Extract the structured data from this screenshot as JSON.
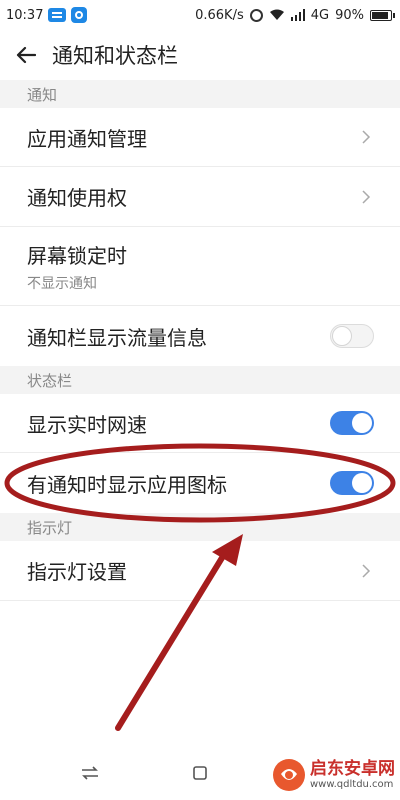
{
  "status_bar": {
    "time": "10:37",
    "speed": "0.66K/s",
    "network": "4G",
    "battery": "90%",
    "icons": [
      "message-icon",
      "app-icon",
      "alarm-icon",
      "wifi-icon",
      "signal-icon",
      "battery-icon"
    ]
  },
  "header": {
    "title": "通知和状态栏",
    "back_icon": "back-arrow-icon"
  },
  "sections": [
    {
      "header": "通知",
      "rows": [
        {
          "title": "应用通知管理",
          "type": "chevron"
        },
        {
          "title": "通知使用权",
          "type": "chevron"
        },
        {
          "title": "屏幕锁定时",
          "subtitle": "不显示通知",
          "type": "text"
        },
        {
          "title": "通知栏显示流量信息",
          "type": "toggle",
          "on": false
        }
      ]
    },
    {
      "header": "状态栏",
      "rows": [
        {
          "title": "显示实时网速",
          "type": "toggle",
          "on": true
        },
        {
          "title": "有通知时显示应用图标",
          "type": "toggle",
          "on": true
        }
      ]
    },
    {
      "header": "指示灯",
      "rows": [
        {
          "title": "指示灯设置",
          "type": "chevron"
        }
      ]
    }
  ],
  "nav": {
    "icons": [
      "menu-icon",
      "home-icon"
    ]
  },
  "watermark": {
    "title": "启东安卓网",
    "url": "www.qdltdu.com"
  },
  "colors": {
    "toggle_on": "#3d82e6",
    "annotation": "#a51d1d",
    "section_bg": "#f3f3f3"
  }
}
